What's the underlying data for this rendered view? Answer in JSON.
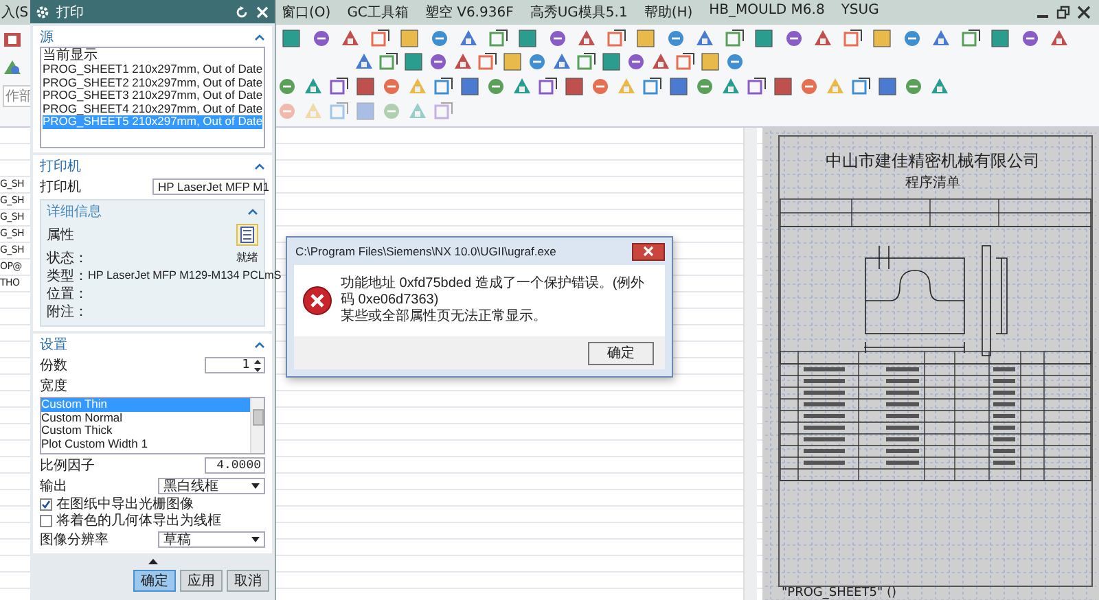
{
  "menu_bar": {
    "left_items": [
      "入(S"
    ],
    "items": [
      "窗口(O)",
      "GC工具箱",
      "塑空 V6.936F",
      "高秀UG模具5.1",
      "帮助(H)",
      "HB_MOULD M6.8",
      "YSUG"
    ]
  },
  "navigator": {
    "search_placeholder": "作部",
    "items": [
      "G_SH",
      "G_SH",
      "G_SH",
      "G_SH",
      "G_SH",
      "OP@",
      "THO"
    ]
  },
  "print_dialog": {
    "title": "打印",
    "source": {
      "title": "源",
      "expanded": true,
      "items": [
        {
          "label": "当前显示",
          "selected": false
        },
        {
          "label": "PROG_SHEET1  210x297mm, Out of Date",
          "selected": false
        },
        {
          "label": "PROG_SHEET2  210x297mm, Out of Date",
          "selected": false
        },
        {
          "label": "PROG_SHEET3  210x297mm, Out of Date",
          "selected": false
        },
        {
          "label": "PROG_SHEET4  210x297mm, Out of Date",
          "selected": false
        },
        {
          "label": "PROG_SHEET5  210x297mm, Out of Date",
          "selected": true
        }
      ]
    },
    "printer": {
      "title": "打印机",
      "expanded": true,
      "label": "打印机",
      "value": "HP LaserJet MFP M1",
      "details": {
        "title": "详细信息",
        "expanded": true,
        "properties_label": "属性",
        "fields": [
          {
            "label": "状态：",
            "value": "就绪"
          },
          {
            "label": "类型：",
            "value": "HP LaserJet MFP M129-M134 PCLmS"
          },
          {
            "label": "位置："
          },
          {
            "label": "附注："
          }
        ]
      }
    },
    "settings": {
      "title": "设置",
      "expanded": true,
      "copies_label": "份数",
      "copies": "1",
      "width_label": "宽度",
      "width_options": [
        {
          "label": "Custom Thin",
          "selected": true
        },
        {
          "label": "Custom Normal",
          "selected": false
        },
        {
          "label": "Custom Thick",
          "selected": false
        },
        {
          "label": "Plot Custom Width 1",
          "selected": false
        }
      ],
      "scale_label": "比例因子",
      "scale": "4.0000",
      "output_label": "输出",
      "output": "黑白线框",
      "checkboxes": [
        {
          "label": "在图纸中导出光栅图像",
          "checked": true
        },
        {
          "label": "将着色的几何体导出为线框",
          "checked": false
        }
      ],
      "resolution_label": "图像分辨率",
      "resolution": "草稿"
    },
    "buttons": [
      {
        "label": "确定",
        "default": true
      },
      {
        "label": "应用",
        "default": false
      },
      {
        "label": "取消",
        "default": false
      }
    ]
  },
  "error_dialog": {
    "title": "C:\\Program Files\\Siemens\\NX 10.0\\UGII\\ugraf.exe",
    "lines": [
      "功能地址 0xfd75bded 造成了一个保护错误。(例外码 0xe06d7363)",
      "某些或全部属性页无法正常显示。"
    ],
    "button": "确定"
  },
  "drawing_sheet": {
    "company": "中山市建佳精密机械有限公司",
    "title": "程序清单",
    "sheet_label": "\"PROG_SHEET5\" ()"
  }
}
